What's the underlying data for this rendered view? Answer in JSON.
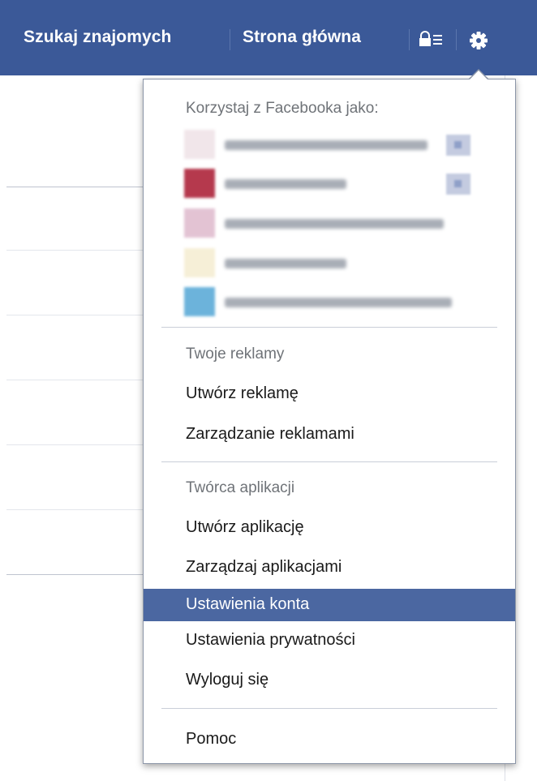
{
  "topbar": {
    "find_friends": "Szukaj znajomych",
    "home": "Strona główna",
    "privacy_shortcuts_icon": "lock-list-icon",
    "account_menu_icon": "gear-icon"
  },
  "menu": {
    "use_as_header": "Korzystaj z Facebooka jako:",
    "pages": [
      {
        "name": "",
        "blurred": true,
        "thumb_color": "#f1e6ea",
        "has_badge": true
      },
      {
        "name": "",
        "blurred": true,
        "thumb_color": "#b5394d",
        "has_badge": true
      },
      {
        "name": "",
        "blurred": true,
        "thumb_color": "#e3c3d3",
        "has_badge": false
      },
      {
        "name": "",
        "blurred": true,
        "thumb_color": "#f6efd7",
        "has_badge": false
      },
      {
        "name": "",
        "blurred": true,
        "thumb_color": "#6cb3db",
        "has_badge": false
      }
    ],
    "ads_header": "Twoje reklamy",
    "create_ad": "Utwórz reklamę",
    "manage_ads": "Zarządzanie reklamami",
    "apps_header": "Twórca aplikacji",
    "create_app": "Utwórz aplikację",
    "manage_apps": "Zarządzaj aplikacjami",
    "account_settings": "Ustawienia konta",
    "privacy_settings": "Ustawienia prywatności",
    "logout": "Wyloguj się",
    "help": "Pomoc"
  },
  "colors": {
    "topbar": "#3b5998",
    "selected_item": "#4b67a1",
    "header_text": "#6f7378"
  }
}
